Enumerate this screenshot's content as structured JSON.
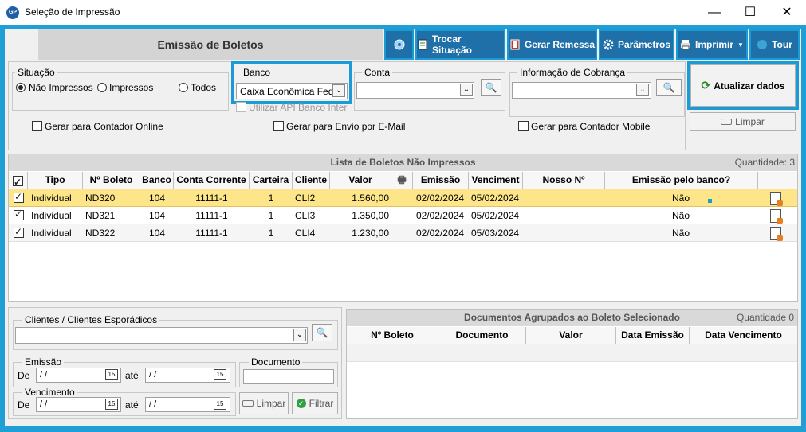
{
  "window": {
    "title": "Seleção de Impressão",
    "icon_text": "GP",
    "minimize": "—",
    "maximize": "☐",
    "close": "✕"
  },
  "toolbar": {
    "title": "Emissão de Boletos",
    "buttons": [
      {
        "label": ""
      },
      {
        "label": "Trocar Situação"
      },
      {
        "label": "Gerar Remessa"
      },
      {
        "label": "Parâmetros"
      },
      {
        "label": "Imprimir"
      },
      {
        "label": "Tour"
      }
    ]
  },
  "filters": {
    "situacao": {
      "legend": "Situação",
      "options": [
        "Não Impressos",
        "Impressos",
        "Todos"
      ],
      "selected": "Não Impressos"
    },
    "banco": {
      "legend": "Banco",
      "value": "Caixa Econômica Feder",
      "api_label": "Utilizar API Banco Inter"
    },
    "conta": {
      "legend": "Conta",
      "value": ""
    },
    "info_cobranca": {
      "legend": "Informação de Cobrança",
      "value": ""
    },
    "chk_contador_online": "Gerar para Contador Online",
    "chk_envio_email": "Gerar para Envio por E-Mail",
    "chk_contador_mobile": "Gerar para Contador Mobile",
    "atualizar_label": "Atualizar dados",
    "limpar_label": "Limpar"
  },
  "list": {
    "title": "Lista de Boletos Não Impressos",
    "quantidade": "Quantidade: 3",
    "columns": [
      "Tipo",
      "Nº Boleto",
      "Banco",
      "Conta Corrente",
      "Carteira",
      "Cliente",
      "Valor",
      "",
      "Emissão",
      "Venciment",
      "Nosso Nº",
      "Emissão pelo banco?"
    ],
    "rows": [
      {
        "tipo": "Individual",
        "boleto": "ND320",
        "banco": "104",
        "conta": "11111-1",
        "carteira": "1",
        "cliente": "CLI2",
        "valor": "1.560,00",
        "emissao": "02/02/2024",
        "venc": "05/02/2024",
        "nosso": "",
        "pelo_banco": "Não"
      },
      {
        "tipo": "Individual",
        "boleto": "ND321",
        "banco": "104",
        "conta": "11111-1",
        "carteira": "1",
        "cliente": "CLI3",
        "valor": "1.350,00",
        "emissao": "02/02/2024",
        "venc": "05/02/2024",
        "nosso": "",
        "pelo_banco": "Não"
      },
      {
        "tipo": "Individual",
        "boleto": "ND322",
        "banco": "104",
        "conta": "11111-1",
        "carteira": "1",
        "cliente": "CLI4",
        "valor": "1.230,00",
        "emissao": "02/02/2024",
        "venc": "05/03/2024",
        "nosso": "",
        "pelo_banco": "Não"
      }
    ]
  },
  "bottom_filters": {
    "clientes_legend": "Clientes / Clientes Esporádicos",
    "emissao_legend": "Emissão",
    "vencimento_legend": "Vencimento",
    "documento_legend": "Documento",
    "de": "De",
    "ate": "até",
    "date_placeholder": " / /",
    "limpar": "Limpar",
    "filtrar": "Filtrar"
  },
  "docs": {
    "title": "Documentos Agrupados ao Boleto Selecionado",
    "quantidade": "Quantidade 0",
    "columns": [
      "Nº Boleto",
      "Documento",
      "Valor",
      "Data Emissão",
      "Data Vencimento"
    ]
  },
  "colors": {
    "accent": "#1a9bd5",
    "toolbar_btn": "#1f6fa9",
    "selected_row": "#fde68a"
  }
}
